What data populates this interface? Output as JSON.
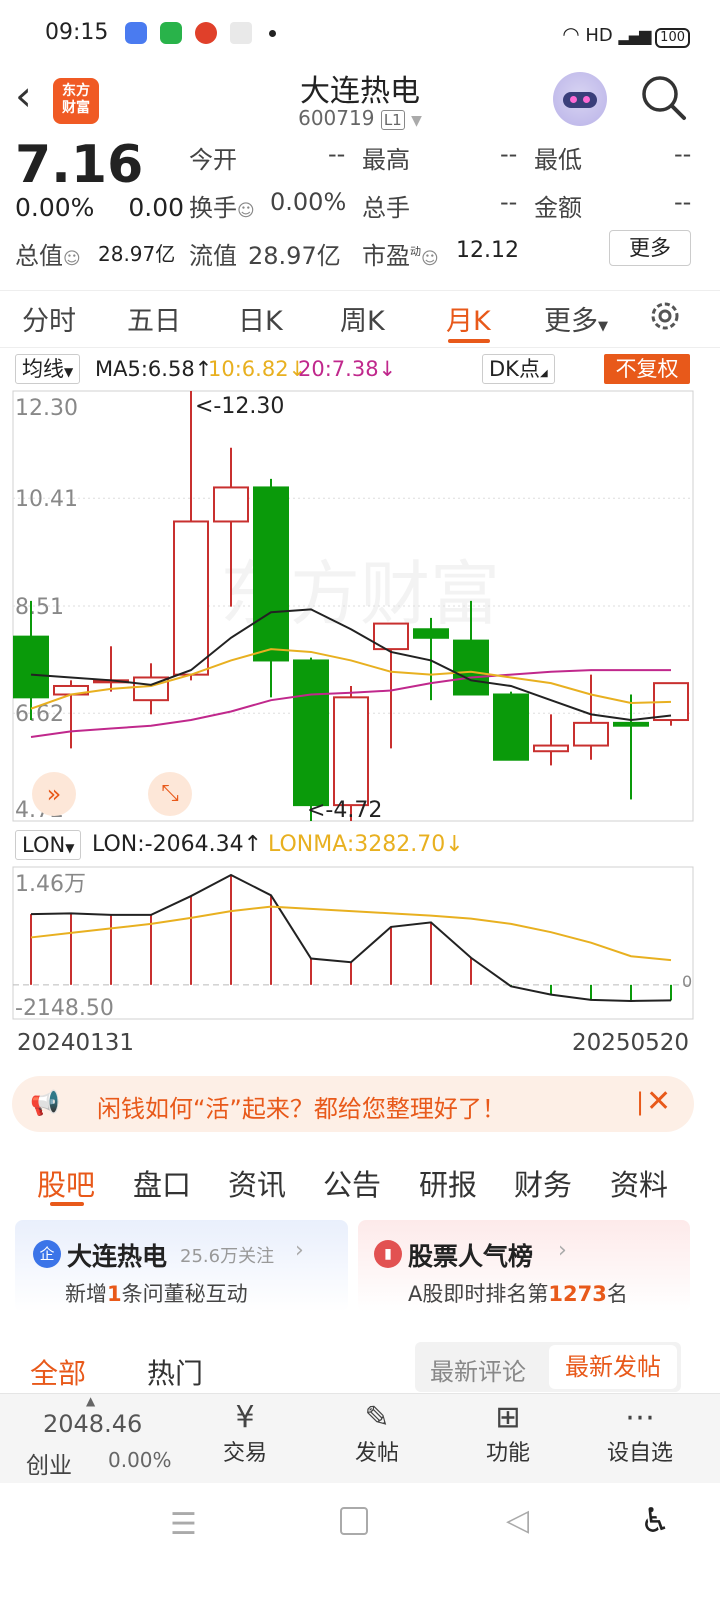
{
  "status_bar": {
    "time": "09:15",
    "network": "HD",
    "battery": "100"
  },
  "header": {
    "title": "大连热电",
    "code": "600719",
    "level_badge": "L1"
  },
  "quote": {
    "price": "7.16",
    "change_pct": "0.00%",
    "change": "0.00",
    "open_label": "今开",
    "open": "--",
    "high_label": "最高",
    "high": "--",
    "low_label": "最低",
    "low": "--",
    "turnover_label": "换手",
    "turnover": "0.00%",
    "volume_label": "总手",
    "volume": "--",
    "amount_label": "金额",
    "amount": "--",
    "mcap_label": "总值",
    "mcap": "28.97亿",
    "float_label": "流值",
    "float": "28.97亿",
    "pe_label": "市盈",
    "pe_sup": "动",
    "pe": "12.12",
    "more": "更多"
  },
  "tabs": [
    "分时",
    "五日",
    "日K",
    "周K",
    "月K",
    "更多"
  ],
  "active_tab": "月K",
  "ma_row": {
    "selector": "均线",
    "ma5": "MA5:6.58↑",
    "ma10": "10:6.82↓",
    "ma20": "20:7.38↓",
    "dk": "DK点",
    "adjust": "不复权"
  },
  "lon_row": {
    "selector": "LON",
    "lon": "LON:-2064.34↑",
    "lonma": "LONMA:3282.70↓"
  },
  "colors": {
    "up": "#c8302f",
    "down": "#0a9a0a",
    "ma5": "#222222",
    "ma10": "#e8b020",
    "ma20": "#c0288c",
    "accent": "#e8591a"
  },
  "chart_data": [
    {
      "type": "candlestick",
      "y_ticks": [
        "12.30",
        "10.41",
        "8.51",
        "6.62",
        "4.72"
      ],
      "ylim": [
        4.72,
        12.3
      ],
      "max_label": "<-12.30",
      "min_label": "<-4.72",
      "start_date": "20240131",
      "end_date": "20250520",
      "candles": [
        {
          "o": 7.97,
          "h": 8.6,
          "l": 6.5,
          "c": 6.9
        },
        {
          "o": 6.95,
          "h": 7.2,
          "l": 6.0,
          "c": 7.1
        },
        {
          "o": 7.2,
          "h": 7.8,
          "l": 7.0,
          "c": 7.2
        },
        {
          "o": 6.85,
          "h": 7.5,
          "l": 6.6,
          "c": 7.25
        },
        {
          "o": 7.3,
          "h": 12.3,
          "l": 7.2,
          "c": 10.0
        },
        {
          "o": 10.0,
          "h": 11.3,
          "l": 8.5,
          "c": 10.6
        },
        {
          "o": 10.6,
          "h": 10.75,
          "l": 6.9,
          "c": 7.55
        },
        {
          "o": 7.55,
          "h": 7.6,
          "l": 4.72,
          "c": 5.0
        },
        {
          "o": 5.0,
          "h": 7.1,
          "l": 4.72,
          "c": 6.9
        },
        {
          "o": 7.75,
          "h": 8.2,
          "l": 6.0,
          "c": 8.2
        },
        {
          "o": 8.1,
          "h": 8.3,
          "l": 6.85,
          "c": 7.95
        },
        {
          "o": 7.9,
          "h": 8.6,
          "l": 6.95,
          "c": 6.95
        },
        {
          "o": 6.95,
          "h": 7.0,
          "l": 5.9,
          "c": 5.8
        },
        {
          "o": 5.95,
          "h": 6.6,
          "l": 5.7,
          "c": 6.05
        },
        {
          "o": 6.05,
          "h": 7.3,
          "l": 5.8,
          "c": 6.45
        },
        {
          "o": 6.45,
          "h": 6.95,
          "l": 5.1,
          "c": 6.4
        },
        {
          "o": 6.5,
          "h": 7.0,
          "l": 6.4,
          "c": 7.15
        }
      ],
      "ma5": [
        7.3,
        7.25,
        7.2,
        7.12,
        7.38,
        7.95,
        8.4,
        8.45,
        8.1,
        7.7,
        7.55,
        7.2,
        7.1,
        6.85,
        6.6,
        6.5,
        6.58
      ],
      "ma10": [
        6.7,
        6.95,
        7.05,
        7.1,
        7.3,
        7.55,
        7.75,
        7.7,
        7.55,
        7.35,
        7.3,
        7.35,
        7.25,
        7.15,
        6.95,
        6.8,
        6.82
      ],
      "ma20": [
        6.2,
        6.3,
        6.35,
        6.4,
        6.5,
        6.65,
        6.85,
        6.95,
        6.98,
        7.02,
        7.15,
        7.25,
        7.3,
        7.35,
        7.38,
        7.38,
        7.38
      ]
    },
    {
      "type": "bar",
      "y_ticks": [
        "1.46万",
        "-2148.50"
      ],
      "zero_label": "0",
      "ylim": [
        -2148.5,
        14600
      ],
      "lon": [
        9400,
        9500,
        9300,
        9300,
        11800,
        14600,
        11900,
        3500,
        3000,
        7700,
        8300,
        3600,
        -200,
        -1300,
        -2000,
        -2148,
        -2064
      ],
      "lonma": [
        6300,
        6900,
        7500,
        8100,
        8900,
        9800,
        10400,
        10100,
        9800,
        9500,
        9200,
        8800,
        8100,
        7000,
        5600,
        3800,
        3283
      ]
    }
  ],
  "banner": {
    "text": "闲钱如何“活”起来？都给您整理好了！"
  },
  "subtabs": [
    "股吧",
    "盘口",
    "资讯",
    "公告",
    "研报",
    "财务",
    "资料"
  ],
  "card_left": {
    "badge": "企",
    "title": "大连热电",
    "follow": "25.6万关注",
    "sub_pre": "新增",
    "sub_num": "1",
    "sub_post": "条问董秘互动"
  },
  "card_right": {
    "title": "股票人气榜",
    "sub_pre": "A股即时排名第",
    "sub_num": "1273",
    "sub_post": "名"
  },
  "feed_tabs": {
    "all": "全部",
    "hot": "热门",
    "latest_comment": "最新评论",
    "latest_post": "最新发帖"
  },
  "bottom_nav": {
    "index_value": "2048.46",
    "index_name": "创业",
    "index_change": "0.00%",
    "trade": "交易",
    "post": "发帖",
    "functions": "功能",
    "watchlist": "设自选"
  }
}
